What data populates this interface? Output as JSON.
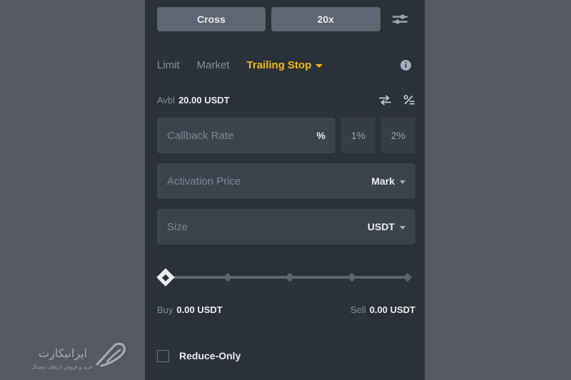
{
  "panel": {
    "margin_mode_button": "Cross",
    "leverage_button": "20x",
    "settings_icon": "sliders-settings-icon",
    "tabs": [
      {
        "label": "Limit",
        "active": false
      },
      {
        "label": "Market",
        "active": false
      },
      {
        "label": "Trailing Stop",
        "active": true
      }
    ],
    "tab_caret_icon": "chevron-down-icon",
    "info_icon": "info-circle-icon",
    "available": {
      "label": "Avbl",
      "value": "20.00 USDT"
    },
    "avbl_icons": [
      {
        "name": "transfer-swap-icon"
      },
      {
        "name": "percent-split-icon"
      }
    ],
    "fields": {
      "callback_rate": {
        "placeholder": "Callback Rate",
        "value": "",
        "unit": "%"
      },
      "activation_price": {
        "placeholder": "Activation Price",
        "value": "",
        "unit": "Mark",
        "caret_icon": "chevron-down-icon"
      },
      "size": {
        "placeholder": "Size",
        "value": "",
        "unit": "USDT",
        "caret_icon": "chevron-down-icon"
      }
    },
    "quick_percent_buttons": [
      "1%",
      "2%"
    ],
    "slider": {
      "value_percent": 0,
      "stops": [
        0,
        25,
        50,
        75,
        100
      ]
    },
    "cost": {
      "buy_label": "Buy",
      "buy_value": "0.00 USDT",
      "sell_label": "Sell",
      "sell_value": "0.00 USDT"
    },
    "reduce_only": {
      "label": "Reduce-Only",
      "checked": false
    }
  },
  "watermark": {
    "brand": "ایرانیکارت",
    "tagline": "خرید و فروش ارزهای دیجیتال"
  },
  "colors": {
    "page_background": "#555a60",
    "panel_background": "#2b3139",
    "field_background": "#3b434d",
    "button_background": "#5e6673",
    "quick_button_background": "#363d47",
    "accent_yellow": "#f0b90b",
    "text_primary": "#eaecef",
    "text_muted": "#848e9c",
    "slider_track": "#5b6471"
  }
}
